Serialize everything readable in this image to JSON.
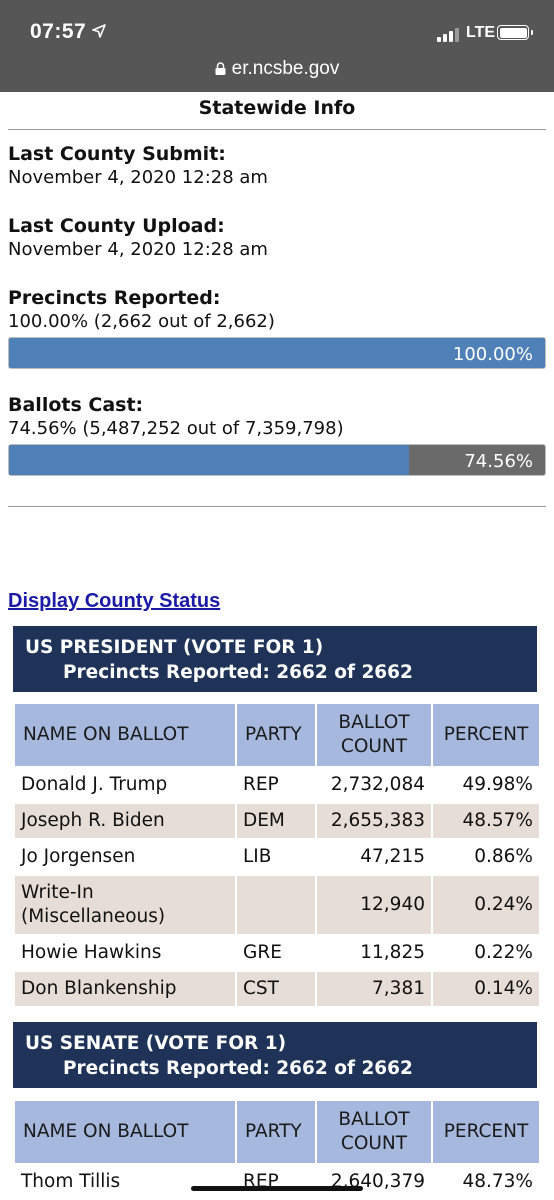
{
  "status_bar": {
    "time": "07:57",
    "network": "LTE"
  },
  "browser": {
    "url": "er.ncsbe.gov"
  },
  "statewide": {
    "title": "Statewide Info",
    "last_submit_label": "Last County Submit:",
    "last_submit_value": "November 4, 2020 12:28 am",
    "last_upload_label": "Last County Upload:",
    "last_upload_value": "November 4, 2020 12:28 am",
    "precincts_label": "Precincts Reported:",
    "precincts_value": "100.00% (2,662 out of 2,662)",
    "precincts_bar_text": "100.00%",
    "precincts_progress": 100.0,
    "ballots_label": "Ballots Cast:",
    "ballots_value": "74.56% (5,487,252 out of 7,359,798)",
    "ballots_bar_text": "74.56%",
    "ballots_progress": 74.56
  },
  "county_link": "Display County Status",
  "table_headers": {
    "name": "NAME ON BALLOT",
    "party": "PARTY",
    "count": "BALLOT COUNT",
    "percent": "PERCENT"
  },
  "races": [
    {
      "title": "US PRESIDENT (VOTE FOR 1)",
      "precincts": "Precincts Reported: 2662 of 2662",
      "candidates": [
        {
          "name": "Donald J. Trump",
          "party": "REP",
          "count": "2,732,084",
          "percent": "49.98%"
        },
        {
          "name": "Joseph R. Biden",
          "party": "DEM",
          "count": "2,655,383",
          "percent": "48.57%"
        },
        {
          "name": "Jo Jorgensen",
          "party": "LIB",
          "count": "47,215",
          "percent": "0.86%"
        },
        {
          "name": "Write-In (Miscellaneous)",
          "party": "",
          "count": "12,940",
          "percent": "0.24%"
        },
        {
          "name": "Howie Hawkins",
          "party": "GRE",
          "count": "11,825",
          "percent": "0.22%"
        },
        {
          "name": "Don Blankenship",
          "party": "CST",
          "count": "7,381",
          "percent": "0.14%"
        }
      ]
    },
    {
      "title": "US SENATE (VOTE FOR 1)",
      "precincts": "Precincts Reported: 2662 of 2662",
      "candidates": [
        {
          "name": "Thom Tillis",
          "party": "REP",
          "count": "2,640,379",
          "percent": "48.73%"
        }
      ]
    }
  ],
  "colors": {
    "header_navy": "#1f3358",
    "th_blue": "#a6b8dd",
    "bar_blue": "#4f81b8",
    "alt_row": "#e6ddd6",
    "link": "#1a1aa6"
  }
}
